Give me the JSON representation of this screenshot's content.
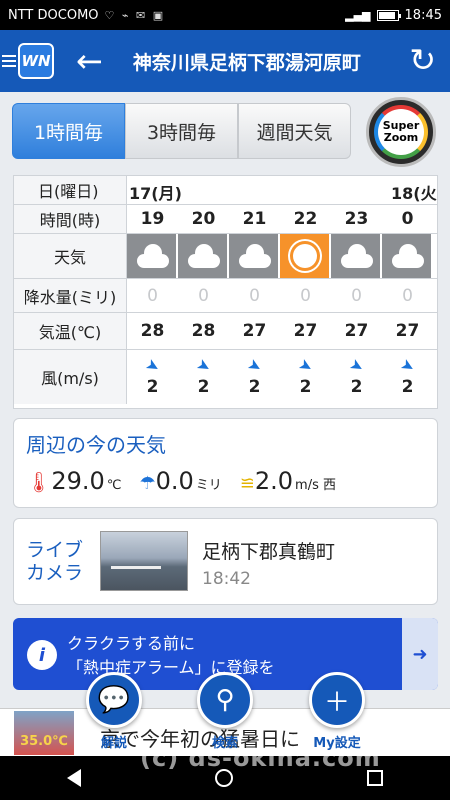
{
  "status_bar": {
    "carrier": "NTT DOCOMO",
    "time": "18:45"
  },
  "header": {
    "logo_text": "WN",
    "location": "神奈川県足柄下郡湯河原町"
  },
  "tabs": [
    "1時間毎",
    "3時間毎",
    "週間天気"
  ],
  "active_tab": "1時間毎",
  "super_zoom": {
    "line1": "Super",
    "line2": "Zoom"
  },
  "forecast": {
    "labels": {
      "date": "日(曜日)",
      "time": "時間(時)",
      "weather": "天気",
      "rain": "降水量(ミリ)",
      "temp": "気温(℃)",
      "wind": "風(m/s)"
    },
    "dates": [
      "17(月)",
      "18(火)"
    ],
    "hours": [
      "19",
      "20",
      "21",
      "22",
      "23",
      "0"
    ],
    "weather_icons": [
      "cloudy-icon",
      "cloudy-icon",
      "cloudy-icon",
      "sunny-icon",
      "cloudy-icon",
      "cloudy-icon"
    ],
    "rain": [
      "0",
      "0",
      "0",
      "0",
      "0",
      "0"
    ],
    "temps": [
      "28",
      "28",
      "27",
      "27",
      "27",
      "27"
    ],
    "wind_speeds": [
      "2",
      "2",
      "2",
      "2",
      "2",
      "2"
    ]
  },
  "current": {
    "title": "周辺の今の天気",
    "temp": "29.0",
    "temp_unit": "℃",
    "rain": "0.0",
    "rain_unit": "ミリ",
    "wind": "2.0",
    "wind_unit": "m/s 西"
  },
  "live_camera": {
    "title_line1": "ライブ",
    "title_line2": "カメラ",
    "place": "足柄下郡真鶴町",
    "time": "18:42"
  },
  "banner": {
    "line1": "クラクラする前に",
    "line2": "「熱中症アラーム」に登録を"
  },
  "ad": {
    "thumb_text": "35.0℃",
    "text": "京で今年初の猛暑日に"
  },
  "fabs": {
    "explain": "解説",
    "search": "検索",
    "my_settings": "My設定"
  },
  "watermark": "(c) ds-okina.com"
}
